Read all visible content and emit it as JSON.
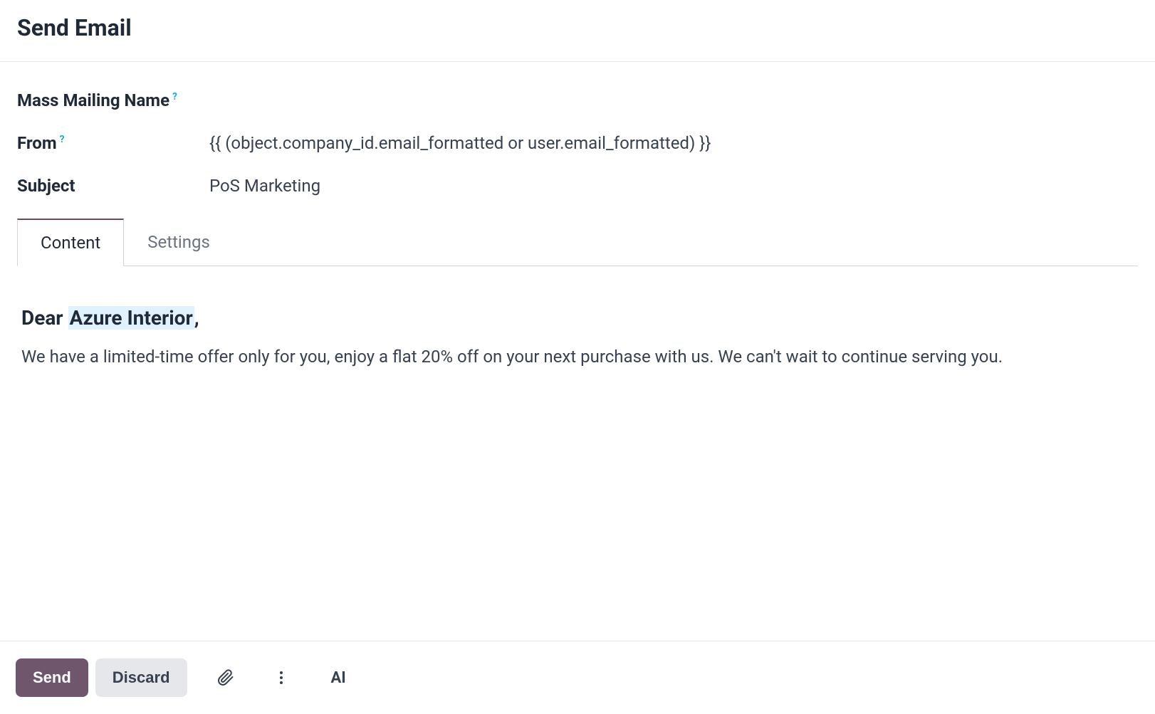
{
  "header": {
    "title": "Send Email"
  },
  "form": {
    "mass_mailing_label": "Mass Mailing Name",
    "mass_mailing_value": "",
    "from_label": "From",
    "from_value": "{{ (object.company_id.email_formatted or user.email_formatted) }}",
    "subject_label": "Subject",
    "subject_value": "PoS Marketing",
    "help_symbol": "?"
  },
  "tabs": {
    "content": "Content",
    "settings": "Settings"
  },
  "content": {
    "greeting_prefix": "Dear ",
    "greeting_highlight": "Azure Interior",
    "greeting_suffix": ",",
    "body": "We have a limited-time offer only for you, enjoy a flat 20% off on your next purchase with us. We can't wait to continue serving you."
  },
  "footer": {
    "send": "Send",
    "discard": "Discard",
    "ai": "AI"
  }
}
